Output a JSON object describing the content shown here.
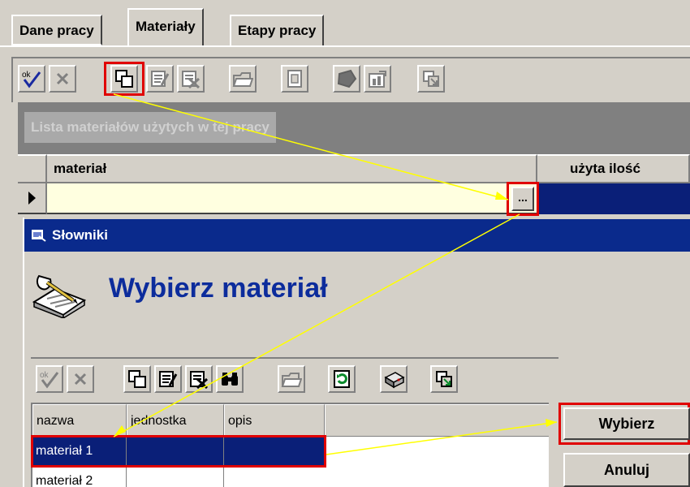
{
  "tabs": [
    "Dane pracy",
    "Materiały",
    "Etapy pracy"
  ],
  "panel_caption": "Lista materiałów użytych w tej pracy",
  "columns": {
    "material": "materiał",
    "qty": "użyta ilość"
  },
  "ellipsis": "...",
  "dialog": {
    "title": "Słowniki",
    "heading": "Wybierz materiał",
    "grid_columns": [
      "nazwa",
      "jednostka",
      "opis"
    ],
    "rows": [
      "materiał 1",
      "materiał 2"
    ],
    "select_button": "Wybierz",
    "cancel_button": "Anuluj"
  },
  "toolbar_icons": [
    "ok-icon",
    "cancel-icon",
    "new-record-icon",
    "edit-record-icon",
    "delete-record-icon",
    "open-folder-icon",
    "document-icon",
    "shape-icon",
    "chart-icon",
    "export-icon"
  ],
  "dialog_toolbar_icons": [
    "ok-icon",
    "cancel-icon",
    "new-record-icon",
    "edit-record-icon",
    "delete-record-icon",
    "binoculars-icon",
    "open-folder-icon",
    "refresh-icon",
    "print-icon",
    "export-icon"
  ],
  "colors": {
    "titlebar": "#0a2a8c",
    "selection": "#0a1f78",
    "highlight": "#e00000",
    "arrow": "#ffff00",
    "heading": "#0c2c9c"
  }
}
